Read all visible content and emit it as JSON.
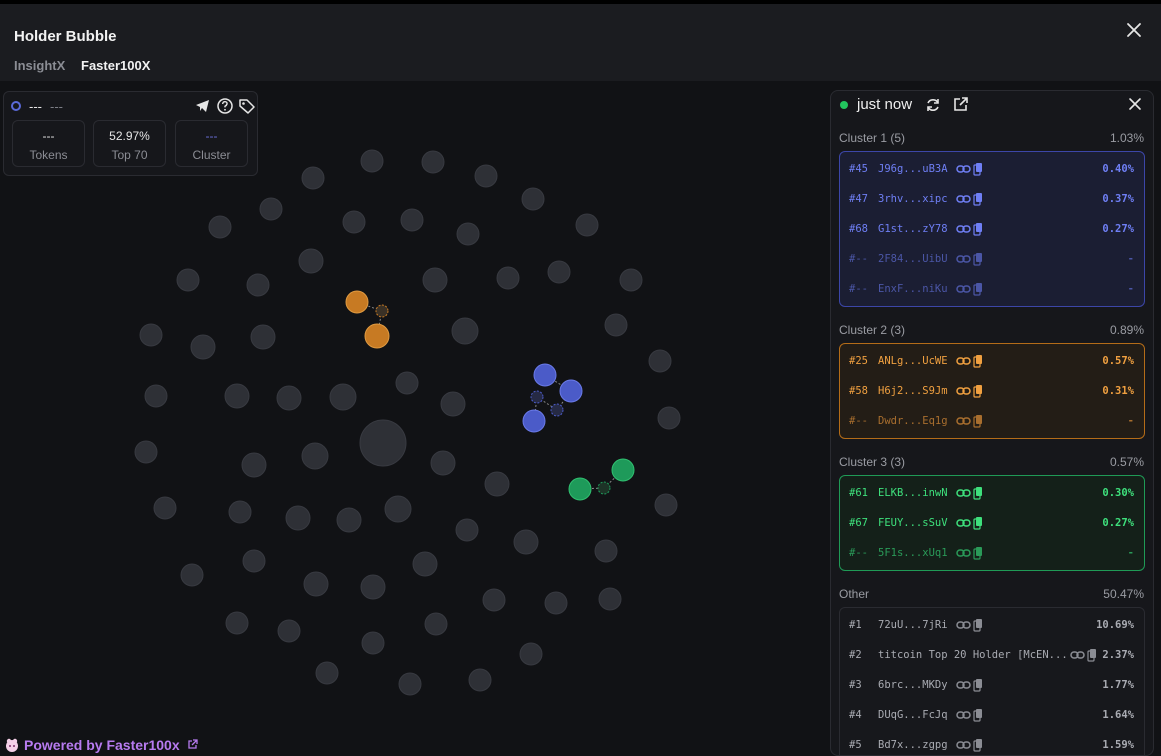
{
  "header": {
    "title": "Holder Bubble",
    "tabs": [
      "InsightX",
      "Faster100X"
    ]
  },
  "info_card": {
    "name": "---",
    "sub": "---",
    "stats": [
      {
        "value": "---",
        "label": "Tokens"
      },
      {
        "value": "52.97%",
        "label": "Top 70"
      },
      {
        "value": "---",
        "label": "Cluster"
      }
    ]
  },
  "panel": {
    "updated": "just now",
    "clusters": [
      {
        "title": "Cluster 1 (5)",
        "pct": "1.03%",
        "color": "#6f7ff5",
        "rows": [
          {
            "rank": "#45",
            "addr": "J96g...uB3A",
            "pct": "0.40%"
          },
          {
            "rank": "#47",
            "addr": "3rhv...xipc",
            "pct": "0.37%"
          },
          {
            "rank": "#68",
            "addr": "G1st...zY78",
            "pct": "0.27%"
          },
          {
            "rank": "#--",
            "addr": "2F84...UibU",
            "pct": "-"
          },
          {
            "rank": "#--",
            "addr": "EnxF...niKu",
            "pct": "-"
          }
        ]
      },
      {
        "title": "Cluster 2 (3)",
        "pct": "0.89%",
        "color": "#f0a040",
        "rows": [
          {
            "rank": "#25",
            "addr": "ANLg...UcWE",
            "pct": "0.57%"
          },
          {
            "rank": "#58",
            "addr": "H6j2...S9Jm",
            "pct": "0.31%"
          },
          {
            "rank": "#--",
            "addr": "Dwdr...Eq1g",
            "pct": "-"
          }
        ]
      },
      {
        "title": "Cluster 3 (3)",
        "pct": "0.57%",
        "color": "#3ee07c",
        "rows": [
          {
            "rank": "#61",
            "addr": "ELKB...inwN",
            "pct": "0.30%"
          },
          {
            "rank": "#67",
            "addr": "FEUY...sSuV",
            "pct": "0.27%"
          },
          {
            "rank": "#--",
            "addr": "5F1s...xUq1",
            "pct": "-"
          }
        ]
      }
    ],
    "other": {
      "title": "Other",
      "pct": "50.47%",
      "rows": [
        {
          "rank": "#1",
          "addr": "72uU...7jRi",
          "pct": "10.69%"
        },
        {
          "rank": "#2",
          "addr": "titcoin Top 20 Holder [McEN...",
          "pct": "2.37%"
        },
        {
          "rank": "#3",
          "addr": "6brc...MKDy",
          "pct": "1.77%"
        },
        {
          "rank": "#4",
          "addr": "DUqG...FcJq",
          "pct": "1.64%"
        },
        {
          "rank": "#5",
          "addr": "Bd7x...zgpg",
          "pct": "1.59%"
        }
      ]
    }
  },
  "footer": {
    "powered_prefix": "Powered by ",
    "brand": "Faster100x"
  },
  "colors": {
    "bubble": "#2e3036",
    "cluster1": "#4b5bc8",
    "cluster2": "#c77a23",
    "cluster3": "#1e9a5a",
    "accent_purple": "#b77bf0"
  }
}
